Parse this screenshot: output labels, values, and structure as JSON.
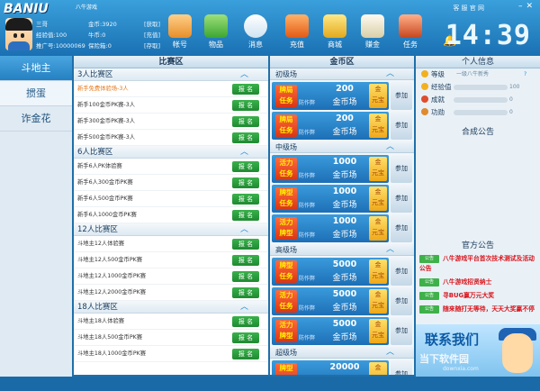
{
  "logo": {
    "text": "BANIU",
    "sub": "八牛游戏"
  },
  "user": {
    "name": "三哥",
    "exp_label": "经验值:",
    "exp": "100",
    "rank_label": "推广号:",
    "rank": "10000069",
    "gold_label": "金币:",
    "gold": "3920",
    "bull_label": "牛币:",
    "bull": "0",
    "deposit_label": "保险箱:",
    "deposit": "0",
    "btn_get": "[获取]",
    "btn_charge": "[充值]",
    "btn_save": "[存取]"
  },
  "toolbar": [
    {
      "label": "帐号",
      "icon": "account-icon",
      "color": "#ffb44a"
    },
    {
      "label": "物品",
      "icon": "bag-icon",
      "color": "#5fc54a"
    },
    {
      "label": "消息",
      "icon": "message-icon",
      "color": "#f6f6f6"
    },
    {
      "label": "充值",
      "icon": "recharge-icon",
      "color": "#ff8a2c"
    },
    {
      "label": "商城",
      "icon": "shop-icon",
      "color": "#f4d35a"
    },
    {
      "label": "赚金",
      "icon": "earn-icon",
      "color": "#eee6c9"
    },
    {
      "label": "任务",
      "icon": "task-icon",
      "color": "#d66b3c"
    }
  ],
  "topright": {
    "links": "客 服 官 网"
  },
  "clock": "14:39",
  "nav": [
    {
      "label": "斗地主"
    },
    {
      "label": "掼蛋"
    },
    {
      "label": "诈金花"
    }
  ],
  "match_area": {
    "title": "比赛区",
    "signup_label": "报 名",
    "groups": [
      {
        "title": "3人比赛区",
        "rows": [
          {
            "text": "新手免费体验场-3人",
            "orange": true
          },
          {
            "text": "新手100金币PK赛-3人"
          },
          {
            "text": "新手300金币PK赛-3人"
          },
          {
            "text": "新手500金币PK赛-3人"
          }
        ]
      },
      {
        "title": "6人比赛区",
        "rows": [
          {
            "text": "新手6人PK体验赛"
          },
          {
            "text": "新手6人300金币PK赛"
          },
          {
            "text": "新手6人500金币PK赛"
          },
          {
            "text": "新手6人1000金币PK赛"
          }
        ]
      },
      {
        "title": "12人比赛区",
        "rows": [
          {
            "text": "斗地主12人体验赛"
          },
          {
            "text": "斗地主12人500金币PK赛"
          },
          {
            "text": "斗地主12人1000金币PK赛"
          },
          {
            "text": "斗地主12人2000金币PK赛"
          }
        ]
      },
      {
        "title": "18人比赛区",
        "rows": [
          {
            "text": "斗地主18人体验赛"
          },
          {
            "text": "斗地主18人500金币PK赛"
          },
          {
            "text": "斗地主18人1000金币PK赛"
          }
        ]
      }
    ]
  },
  "gold_area": {
    "title": "金币区",
    "unit": "金币场",
    "ingot": "金元宝",
    "join": "参加",
    "note": "防作弊",
    "fields": [
      {
        "title": "初级场",
        "cards": [
          {
            "task": "牌局任务",
            "amount": "200"
          },
          {
            "task": "牌局任务",
            "amount": "200"
          }
        ]
      },
      {
        "title": "中级场",
        "cards": [
          {
            "task": "活力任务",
            "amount": "1000"
          },
          {
            "task": "牌型任务",
            "amount": "1000"
          },
          {
            "task": "活力牌型",
            "amount": "1000"
          }
        ]
      },
      {
        "title": "高级场",
        "cards": [
          {
            "task": "牌型任务",
            "amount": "5000"
          },
          {
            "task": "活力任务",
            "amount": "5000"
          },
          {
            "task": "活力牌型",
            "amount": "5000"
          }
        ]
      },
      {
        "title": "超级场",
        "cards": [
          {
            "task": "牌型任务",
            "amount": "20000"
          }
        ]
      }
    ]
  },
  "personal": {
    "title": "个人信息",
    "stats": [
      {
        "label": "等级",
        "value": "一级八牛新秀",
        "icon": "level-icon"
      },
      {
        "label": "经验值",
        "value": "",
        "num": "100",
        "icon": "exp-icon"
      },
      {
        "label": "成就",
        "value": "",
        "num": "0",
        "icon": "achievement-icon"
      },
      {
        "label": "功勋",
        "value": "",
        "num": "0",
        "icon": "merit-icon"
      }
    ],
    "question": "?"
  },
  "synthesis_title": "合成公告",
  "official": {
    "title": "官方公告",
    "tag": "公告",
    "items": [
      {
        "text": "八牛游戏平台首次技术测试及活动公告"
      },
      {
        "text": "八牛游戏招贤纳士"
      },
      {
        "text": "寻BUG赢万元大奖"
      },
      {
        "text": "随来随打无等待，天天大奖赢不停"
      }
    ]
  },
  "contact": {
    "title": "联系我们",
    "watermark": "当下软件园",
    "watermark_url": "downxia.com"
  }
}
